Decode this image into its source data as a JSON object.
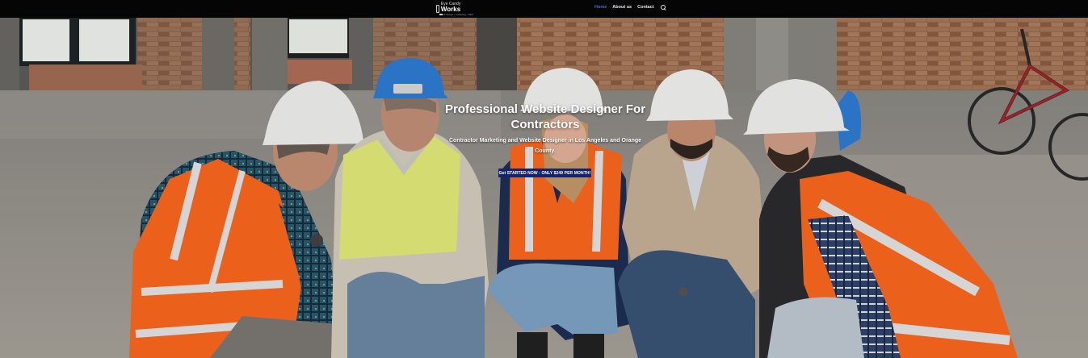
{
  "header": {
    "logo": {
      "line1": "Eye Candy",
      "line2": "Works",
      "tagline": "web design • marketing • SEO"
    },
    "nav": [
      {
        "label": "Home",
        "active": true
      },
      {
        "label": "About us",
        "active": false
      },
      {
        "label": "Contact",
        "active": false
      }
    ],
    "search_icon": "search-icon"
  },
  "hero": {
    "title": "Professional Website Designer For Contractors",
    "subtitle": "Contractor Marketing and Website Designer in Los Angeles and Orange County.",
    "cta_label": "Get STARTED NOW - ONLY $249 PER MONTH!",
    "image": "construction-workers-kneeling-photo"
  },
  "colors": {
    "topbar": "#050505",
    "nav_active": "#3a6fd8",
    "cta_bg": "#14246a",
    "safety_orange": "#ff6a1f"
  }
}
